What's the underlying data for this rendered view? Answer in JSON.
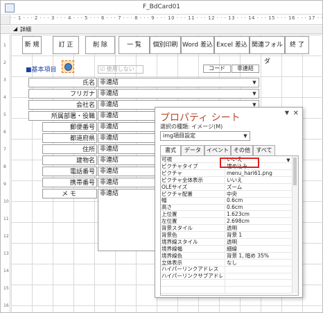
{
  "window": {
    "title": "F_BdCard01"
  },
  "ruler": {
    "text": "· · 1 · · · 2 · · · 3 · · · 4 · · · 5 · · · 6 · · · 7 · · · 8 · · · 9 · · · 10 · · · 11 · · · 12 · · · 13 · · · 14 · · · 15 · · · 16 · · · 17 · · · 18"
  },
  "section": {
    "label": "詳細"
  },
  "vruler": [
    "1",
    "2",
    "3",
    "4",
    "5",
    "6",
    "7",
    "8",
    "9",
    "10",
    "11",
    "12",
    "13",
    "14",
    "15",
    "16"
  ],
  "toolbar": [
    "新 規",
    "訂 正",
    "削 除",
    "一 覧",
    "個別印刷",
    "Word 差込",
    "Excel 差込",
    "関連フォルダ",
    "終 了"
  ],
  "header": {
    "basic_items": "■基本項目",
    "unused": "使用しない",
    "code": "コード",
    "nonlink": "非連結"
  },
  "fields": [
    {
      "label": "氏名",
      "value": "非連結"
    },
    {
      "label": "フリガナ",
      "value": "非連結"
    },
    {
      "label": "会社名",
      "value": "非連結"
    },
    {
      "label": "所属部署・役職",
      "value": "非連結"
    },
    {
      "label": "郵便番号",
      "value": "非連結"
    },
    {
      "label": "都道府県",
      "value": "非連結"
    },
    {
      "label": "住所",
      "value": "非連結"
    },
    {
      "label": "建物名",
      "value": "非連結"
    },
    {
      "label": "電話番号",
      "value": "非連結"
    },
    {
      "label": "携帯番号",
      "value": "非連結"
    },
    {
      "label": "メ モ",
      "value": "非連結"
    }
  ],
  "property_sheet": {
    "title": "プロパティ シート",
    "subtitle": "選択の種類: イメージ(M)",
    "selector": "img項目設定",
    "tabs": [
      "書式",
      "データ",
      "イベント",
      "その他",
      "すべて"
    ],
    "rows": [
      {
        "k": "可視",
        "v": "いいえ"
      },
      {
        "k": "ピクチャタイプ",
        "v": "埋め込み"
      },
      {
        "k": "ピクチャ",
        "v": "menu_hari61.png"
      },
      {
        "k": "ピクチャ全体表示",
        "v": "いいえ"
      },
      {
        "k": "OLEサイズ",
        "v": "ズーム"
      },
      {
        "k": "ピクチャ配置",
        "v": "中央"
      },
      {
        "k": "幅",
        "v": "0.6cm"
      },
      {
        "k": "高さ",
        "v": "0.6cm"
      },
      {
        "k": "上位置",
        "v": "1.623cm"
      },
      {
        "k": "左位置",
        "v": "2.698cm"
      },
      {
        "k": "背景スタイル",
        "v": "透明"
      },
      {
        "k": "背景色",
        "v": "背景 1"
      },
      {
        "k": "境界線スタイル",
        "v": "透明"
      },
      {
        "k": "境界線幅",
        "v": "細線"
      },
      {
        "k": "境界線色",
        "v": "背景 1, 暗め 35%"
      },
      {
        "k": "立体表示",
        "v": "なし"
      },
      {
        "k": "ハイパーリンクアドレス",
        "v": ""
      },
      {
        "k": "ハイパーリンクサブアドレス",
        "v": ""
      },
      {
        "k": "",
        "v": ""
      },
      {
        "k": "",
        "v": ""
      }
    ]
  },
  "colors": {
    "accent": "#b7472a",
    "highlight": "#e0201b"
  }
}
